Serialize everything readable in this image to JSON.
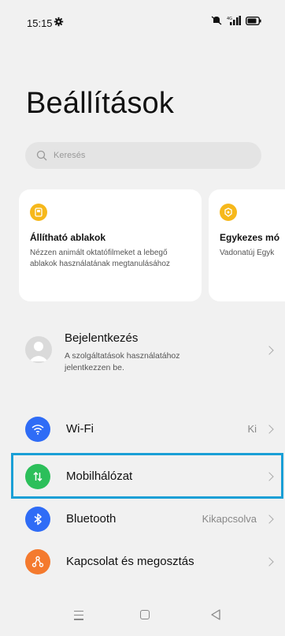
{
  "status_bar": {
    "time": "15:15",
    "icons": [
      "gear-icon",
      "mute-icon",
      "signal-icon",
      "battery-icon"
    ]
  },
  "page": {
    "title": "Beállítások"
  },
  "search": {
    "placeholder": "Keresés"
  },
  "cards": [
    {
      "title": "Állítható ablakok",
      "description": "Nézzen animált oktatófilmeket a lebegő ablakok használatának megtanulásához",
      "icon": "window-icon"
    },
    {
      "title": "Egykezes mó",
      "description": "Vadonatúj Egyk",
      "icon": "hand-icon"
    }
  ],
  "login": {
    "title": "Bejelentkezés",
    "description": "A szolgáltatások használatához jelentkezzen be."
  },
  "settings": [
    {
      "label": "Wi-Fi",
      "value": "Ki",
      "icon": "wifi-icon",
      "color": "#2f6cf6"
    },
    {
      "label": "Mobilhálózat",
      "value": "",
      "icon": "mobile-data-icon",
      "color": "#2cbf5a"
    },
    {
      "label": "Bluetooth",
      "value": "Kikapcsolva",
      "icon": "bluetooth-icon",
      "color": "#2f6cf6"
    },
    {
      "label": "Kapcsolat és megosztás",
      "value": "",
      "icon": "connection-icon",
      "color": "#f47a2e"
    }
  ],
  "colors": {
    "highlight": "#1a9fd6",
    "card_icon": "#f6b81b"
  }
}
